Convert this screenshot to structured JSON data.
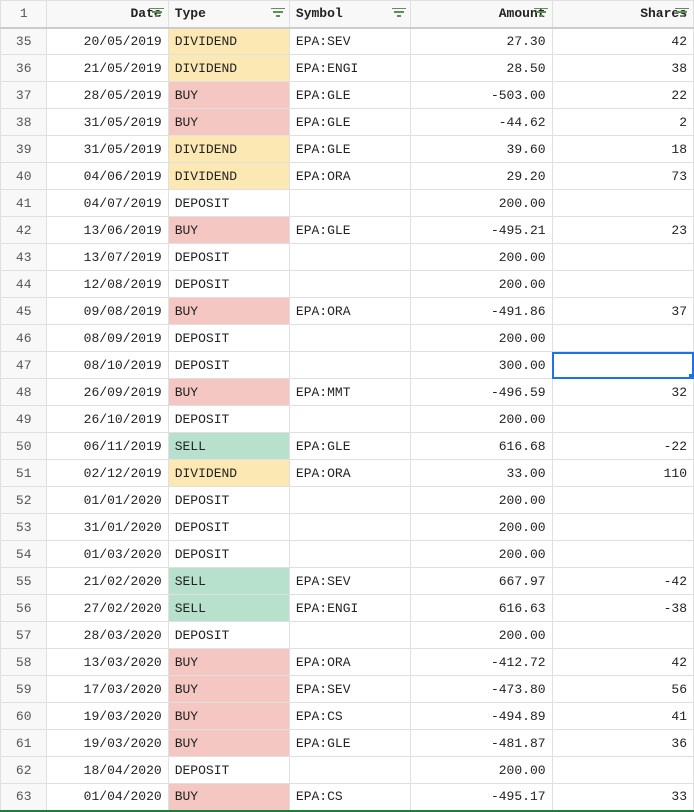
{
  "corner_label": "1",
  "columns": [
    {
      "key": "date",
      "label": "Date",
      "class": "col-date"
    },
    {
      "key": "type",
      "label": "Type",
      "class": "col-type"
    },
    {
      "key": "symbol",
      "label": "Symbol",
      "class": "col-symbol"
    },
    {
      "key": "amount",
      "label": "Amount",
      "class": "col-amount"
    },
    {
      "key": "shares",
      "label": "Shares",
      "class": "col-shares"
    }
  ],
  "selected_cell": {
    "row_index": 12,
    "col_key": "shares"
  },
  "rows": [
    {
      "n": "35",
      "date": "20/05/2019",
      "type": "DIVIDEND",
      "symbol": "EPA:SEV",
      "amount": "27.30",
      "shares": "42"
    },
    {
      "n": "36",
      "date": "21/05/2019",
      "type": "DIVIDEND",
      "symbol": "EPA:ENGI",
      "amount": "28.50",
      "shares": "38"
    },
    {
      "n": "37",
      "date": "28/05/2019",
      "type": "BUY",
      "symbol": "EPA:GLE",
      "amount": "-503.00",
      "shares": "22"
    },
    {
      "n": "38",
      "date": "31/05/2019",
      "type": "BUY",
      "symbol": "EPA:GLE",
      "amount": "-44.62",
      "shares": "2"
    },
    {
      "n": "39",
      "date": "31/05/2019",
      "type": "DIVIDEND",
      "symbol": "EPA:GLE",
      "amount": "39.60",
      "shares": "18"
    },
    {
      "n": "40",
      "date": "04/06/2019",
      "type": "DIVIDEND",
      "symbol": "EPA:ORA",
      "amount": "29.20",
      "shares": "73"
    },
    {
      "n": "41",
      "date": "04/07/2019",
      "type": "DEPOSIT",
      "symbol": "",
      "amount": "200.00",
      "shares": ""
    },
    {
      "n": "42",
      "date": "13/06/2019",
      "type": "BUY",
      "symbol": "EPA:GLE",
      "amount": "-495.21",
      "shares": "23"
    },
    {
      "n": "43",
      "date": "13/07/2019",
      "type": "DEPOSIT",
      "symbol": "",
      "amount": "200.00",
      "shares": ""
    },
    {
      "n": "44",
      "date": "12/08/2019",
      "type": "DEPOSIT",
      "symbol": "",
      "amount": "200.00",
      "shares": ""
    },
    {
      "n": "45",
      "date": "09/08/2019",
      "type": "BUY",
      "symbol": "EPA:ORA",
      "amount": "-491.86",
      "shares": "37"
    },
    {
      "n": "46",
      "date": "08/09/2019",
      "type": "DEPOSIT",
      "symbol": "",
      "amount": "200.00",
      "shares": ""
    },
    {
      "n": "47",
      "date": "08/10/2019",
      "type": "DEPOSIT",
      "symbol": "",
      "amount": "300.00",
      "shares": ""
    },
    {
      "n": "48",
      "date": "26/09/2019",
      "type": "BUY",
      "symbol": "EPA:MMT",
      "amount": "-496.59",
      "shares": "32"
    },
    {
      "n": "49",
      "date": "26/10/2019",
      "type": "DEPOSIT",
      "symbol": "",
      "amount": "200.00",
      "shares": ""
    },
    {
      "n": "50",
      "date": "06/11/2019",
      "type": "SELL",
      "symbol": "EPA:GLE",
      "amount": "616.68",
      "shares": "-22"
    },
    {
      "n": "51",
      "date": "02/12/2019",
      "type": "DIVIDEND",
      "symbol": "EPA:ORA",
      "amount": "33.00",
      "shares": "110"
    },
    {
      "n": "52",
      "date": "01/01/2020",
      "type": "DEPOSIT",
      "symbol": "",
      "amount": "200.00",
      "shares": ""
    },
    {
      "n": "53",
      "date": "31/01/2020",
      "type": "DEPOSIT",
      "symbol": "",
      "amount": "200.00",
      "shares": ""
    },
    {
      "n": "54",
      "date": "01/03/2020",
      "type": "DEPOSIT",
      "symbol": "",
      "amount": "200.00",
      "shares": ""
    },
    {
      "n": "55",
      "date": "21/02/2020",
      "type": "SELL",
      "symbol": "EPA:SEV",
      "amount": "667.97",
      "shares": "-42"
    },
    {
      "n": "56",
      "date": "27/02/2020",
      "type": "SELL",
      "symbol": "EPA:ENGI",
      "amount": "616.63",
      "shares": "-38"
    },
    {
      "n": "57",
      "date": "28/03/2020",
      "type": "DEPOSIT",
      "symbol": "",
      "amount": "200.00",
      "shares": ""
    },
    {
      "n": "58",
      "date": "13/03/2020",
      "type": "BUY",
      "symbol": "EPA:ORA",
      "amount": "-412.72",
      "shares": "42"
    },
    {
      "n": "59",
      "date": "17/03/2020",
      "type": "BUY",
      "symbol": "EPA:SEV",
      "amount": "-473.80",
      "shares": "56"
    },
    {
      "n": "60",
      "date": "19/03/2020",
      "type": "BUY",
      "symbol": "EPA:CS",
      "amount": "-494.89",
      "shares": "41"
    },
    {
      "n": "61",
      "date": "19/03/2020",
      "type": "BUY",
      "symbol": "EPA:GLE",
      "amount": "-481.87",
      "shares": "36"
    },
    {
      "n": "62",
      "date": "18/04/2020",
      "type": "DEPOSIT",
      "symbol": "",
      "amount": "200.00",
      "shares": ""
    },
    {
      "n": "63",
      "date": "01/04/2020",
      "type": "BUY",
      "symbol": "EPA:CS",
      "amount": "-495.17",
      "shares": "33"
    }
  ],
  "type_classes": {
    "BUY": "type-buy",
    "SELL": "type-sell",
    "DIVIDEND": "type-dividend",
    "DEPOSIT": "type-deposit"
  }
}
